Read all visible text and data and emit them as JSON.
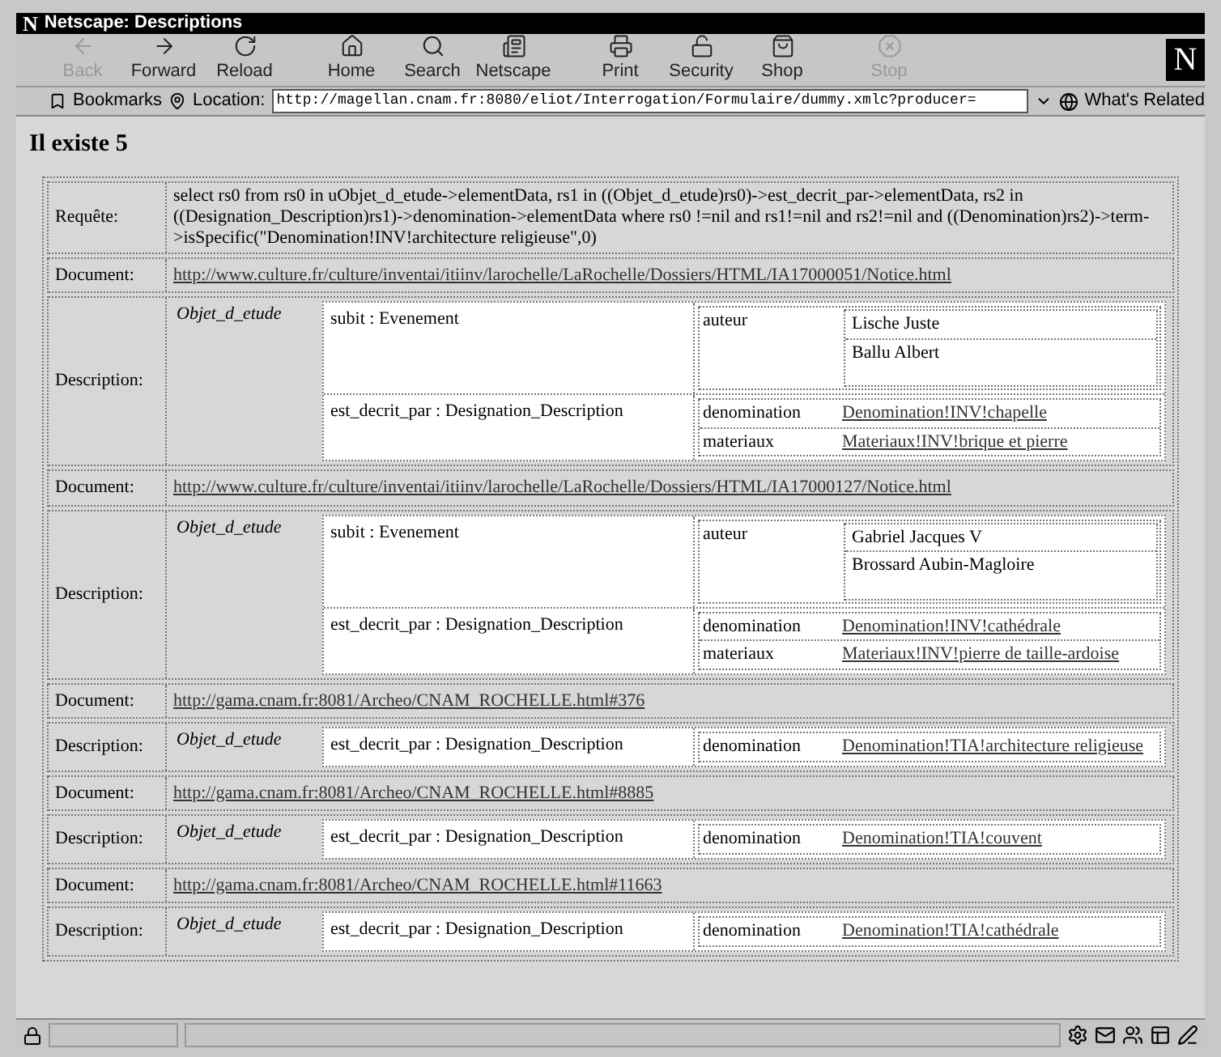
{
  "window": {
    "logo": "N",
    "title": "Netscape: Descriptions"
  },
  "toolbar": {
    "buttons": [
      {
        "label": "Back",
        "disabled": true
      },
      {
        "label": "Forward",
        "disabled": false
      },
      {
        "label": "Reload",
        "disabled": false
      },
      {
        "label": "Home",
        "disabled": false
      },
      {
        "label": "Search",
        "disabled": false
      },
      {
        "label": "Netscape",
        "disabled": false
      },
      {
        "label": "Print",
        "disabled": false
      },
      {
        "label": "Security",
        "disabled": false
      },
      {
        "label": "Shop",
        "disabled": false
      },
      {
        "label": "Stop",
        "disabled": true
      }
    ],
    "logo": "N"
  },
  "location_bar": {
    "bookmarks": "Bookmarks",
    "location_label": "Location:",
    "url": "http://magellan.cnam.fr:8080/eliot/Interrogation/Formulaire/dummy.xmlc?producer=",
    "related": "What's Related"
  },
  "heading": "Il existe 5",
  "results": {
    "query": {
      "label": "Requête:",
      "text": "select rs0 from rs0 in uObjet_d_etude->elementData, rs1 in ((Objet_d_etude)rs0)->est_decrit_par->elementData, rs2 in ((Designation_Description)rs1)->denomination->elementData where rs0 !=nil and rs1!=nil and rs2!=nil and ((Denomination)rs2)->term->isSpecific(\"Denomination!INV!architecture religieuse\",0)"
    },
    "rows": [
      {
        "kind": "document",
        "label": "Document:",
        "url": "http://www.culture.fr/culture/inventai/itiinv/larochelle/LaRochelle/Dossiers/HTML/IA17000051/Notice.html"
      },
      {
        "kind": "description",
        "label": "Description:",
        "object": "Objet_d_etude",
        "properties": [
          {
            "kind": "list",
            "label": "subit : Evenement",
            "name": "auteur",
            "items": [
              "Lische Juste",
              "Ballu Albert"
            ]
          },
          {
            "kind": "links",
            "label": "est_decrit_par : Designation_Description",
            "pairs": [
              {
                "name": "denomination",
                "value": "Denomination!INV!chapelle"
              },
              {
                "name": "materiaux",
                "value": "Materiaux!INV!brique et pierre"
              }
            ]
          }
        ]
      },
      {
        "kind": "document",
        "label": "Document:",
        "url": "http://www.culture.fr/culture/inventai/itiinv/larochelle/LaRochelle/Dossiers/HTML/IA17000127/Notice.html"
      },
      {
        "kind": "description",
        "label": "Description:",
        "object": "Objet_d_etude",
        "properties": [
          {
            "kind": "list",
            "label": "subit : Evenement",
            "name": "auteur",
            "items": [
              "Gabriel Jacques V",
              "Brossard Aubin-Magloire"
            ]
          },
          {
            "kind": "links",
            "label": "est_decrit_par : Designation_Description",
            "pairs": [
              {
                "name": "denomination",
                "value": "Denomination!INV!cathédrale"
              },
              {
                "name": "materiaux",
                "value": "Materiaux!INV!pierre de taille-ardoise"
              }
            ]
          }
        ]
      },
      {
        "kind": "document",
        "label": "Document:",
        "url": "http://gama.cnam.fr:8081/Archeo/CNAM_ROCHELLE.html#376"
      },
      {
        "kind": "description",
        "label": "Description:",
        "object": "Objet_d_etude",
        "properties": [
          {
            "kind": "links",
            "label": "est_decrit_par : Designation_Description",
            "pairs": [
              {
                "name": "denomination",
                "value": "Denomination!TIA!architecture religieuse"
              }
            ]
          }
        ]
      },
      {
        "kind": "document",
        "label": "Document:",
        "url": "http://gama.cnam.fr:8081/Archeo/CNAM_ROCHELLE.html#8885"
      },
      {
        "kind": "description",
        "label": "Description:",
        "object": "Objet_d_etude",
        "properties": [
          {
            "kind": "links",
            "label": "est_decrit_par : Designation_Description",
            "pairs": [
              {
                "name": "denomination",
                "value": "Denomination!TIA!couvent"
              }
            ]
          }
        ]
      },
      {
        "kind": "document",
        "label": "Document:",
        "url": "http://gama.cnam.fr:8081/Archeo/CNAM_ROCHELLE.html#11663"
      },
      {
        "kind": "description",
        "label": "Description:",
        "object": "Objet_d_etude",
        "properties": [
          {
            "kind": "links",
            "label": "est_decrit_par : Designation_Description",
            "pairs": [
              {
                "name": "denomination",
                "value": "Denomination!TIA!cathédrale"
              }
            ]
          }
        ]
      }
    ]
  }
}
